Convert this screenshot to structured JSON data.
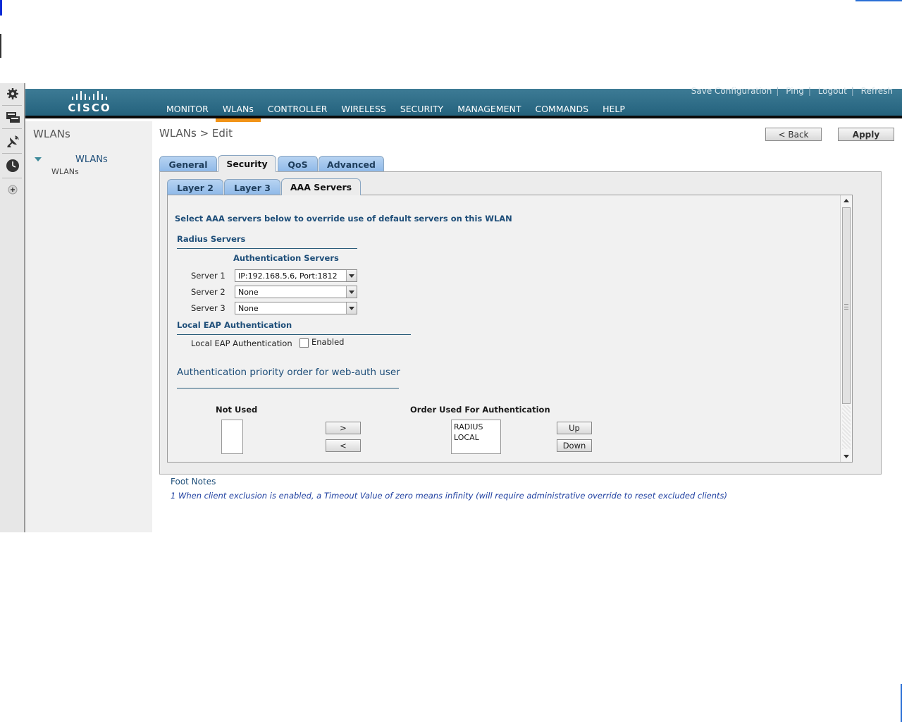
{
  "header": {
    "logo_text": "CISCO",
    "top_links": [
      "Save Configuration",
      "Ping",
      "Logout",
      "Refresh"
    ],
    "nav": [
      {
        "label": "MONITOR",
        "active": false
      },
      {
        "label": "WLANs",
        "active": true
      },
      {
        "label": "CONTROLLER",
        "active": false
      },
      {
        "label": "WIRELESS",
        "active": false
      },
      {
        "label": "SECURITY",
        "active": false
      },
      {
        "label": "MANAGEMENT",
        "active": false
      },
      {
        "label": "COMMANDS",
        "active": false
      },
      {
        "label": "HELP",
        "active": false
      }
    ],
    "accent_color": "#f29418"
  },
  "left_toolbar": {
    "icons": [
      "gear-icon",
      "monitor-icon",
      "satellite-dish-icon",
      "clock-icon",
      "expand-icon"
    ]
  },
  "left_nav": {
    "title": "WLANs",
    "tree_label": "WLANs",
    "tree_sub": "WLANs"
  },
  "page": {
    "title": "WLANs > Edit",
    "back_label": "< Back",
    "apply_label": "Apply"
  },
  "tabs": [
    {
      "label": "General",
      "active": false
    },
    {
      "label": "Security",
      "active": true
    },
    {
      "label": "QoS",
      "active": false
    },
    {
      "label": "Advanced",
      "active": false
    }
  ],
  "subtabs": [
    {
      "label": "Layer 2",
      "active": false
    },
    {
      "label": "Layer 3",
      "active": false
    },
    {
      "label": "AAA Servers",
      "active": true
    }
  ],
  "aaa": {
    "intro": "Select AAA servers below to override use of default servers on this WLAN",
    "radius_heading": "Radius Servers",
    "auth_servers_heading": "Authentication Servers",
    "servers": [
      {
        "label": "Server 1",
        "value": "IP:192.168.5.6, Port:1812"
      },
      {
        "label": "Server 2",
        "value": "None"
      },
      {
        "label": "Server 3",
        "value": "None"
      }
    ],
    "local_eap_heading": "Local EAP Authentication",
    "local_eap_label": "Local EAP Authentication",
    "local_eap_checkbox_label": "Enabled",
    "local_eap_enabled": false,
    "priority_heading": "Authentication priority order for web-auth user",
    "not_used_label": "Not Used",
    "order_used_label": "Order Used For Authentication",
    "not_used_items": [],
    "order_items": [
      "RADIUS",
      "LOCAL"
    ],
    "move_right_label": ">",
    "move_left_label": "<",
    "up_label": "Up",
    "down_label": "Down"
  },
  "foot": {
    "title": "Foot Notes",
    "note": "1 When client exclusion is enabled, a Timeout Value of zero means infinity (will require administrative override to reset excluded clients)"
  }
}
